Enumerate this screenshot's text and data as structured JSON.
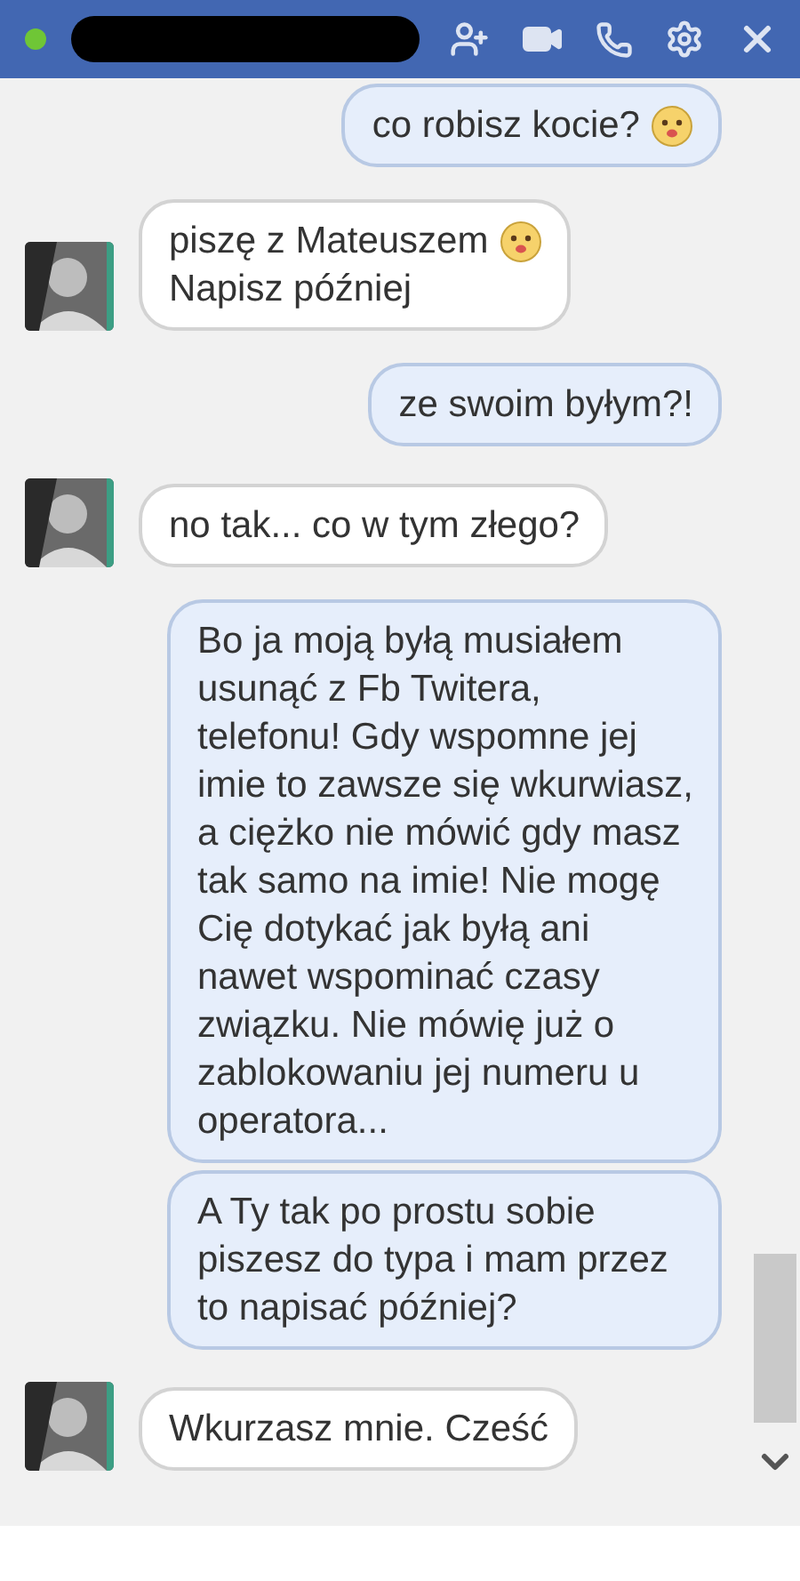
{
  "header": {
    "online": true
  },
  "messages": [
    {
      "kind": "outgoing",
      "lines": [
        "co robisz kocie?"
      ],
      "emoji": true
    },
    {
      "kind": "incoming",
      "lines": [
        "piszę z Mateuszem",
        "Napisz później"
      ],
      "emoji": true
    },
    {
      "kind": "outgoing",
      "lines": [
        "ze swoim byłym?!"
      ],
      "emoji": false
    },
    {
      "kind": "incoming",
      "lines": [
        "no tak... co w tym złego?"
      ],
      "emoji": false
    },
    {
      "kind": "outgoing",
      "lines": [
        "Bo ja moją byłą musiałem usunąć z Fb Twitera, telefonu! Gdy wspomne jej imie to zawsze się wkurwiasz, a ciężko nie mówić gdy masz tak samo na imie! Nie mogę Cię dotykać jak byłą ani nawet wspominać czasy związku. Nie mówię już o zablokowaniu jej numeru u operatora..."
      ],
      "emoji": false
    },
    {
      "kind": "outgoing",
      "lines": [
        "A Ty tak po prostu sobie piszesz do typa i mam przez to napisać później?"
      ],
      "emoji": false
    },
    {
      "kind": "incoming",
      "lines": [
        "Wkurzasz mnie. Cześć"
      ],
      "emoji": false
    }
  ]
}
